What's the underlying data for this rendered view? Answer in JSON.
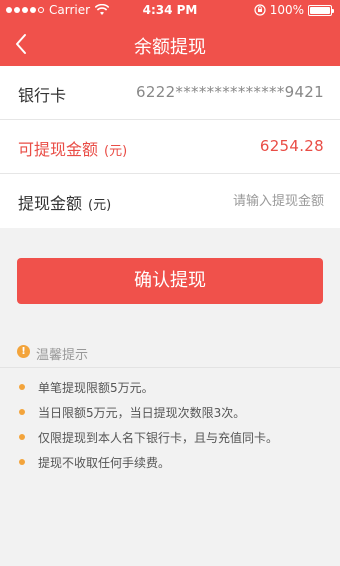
{
  "status_bar": {
    "carrier": "Carrier",
    "time": "4:34 PM",
    "battery": "100%"
  },
  "nav": {
    "title": "余额提现",
    "back_icon": "chevron-left-icon"
  },
  "form": {
    "bank_card_label": "银行卡",
    "bank_card_value": "6222**************9421",
    "available_label": "可提现金额",
    "available_unit": "(元)",
    "available_value": "6254.28",
    "amount_label": "提现金额",
    "amount_unit": "(元)",
    "amount_placeholder": "请输入提现金额",
    "amount_value": ""
  },
  "confirm_button": "确认提现",
  "tips": {
    "title": "温馨提示",
    "icon": "info-icon",
    "items": [
      "单笔提现限额5万元。",
      "当日限额5万元，当日提现次数限3次。",
      "仅限提现到本人名下银行卡，且与充值同卡。",
      "提现不收取任何手续费。"
    ]
  },
  "colors": {
    "accent": "#f0514b",
    "accent_text": "#e94d46",
    "tip_bullet": "#f3a43b",
    "background": "#f2f2f2"
  }
}
